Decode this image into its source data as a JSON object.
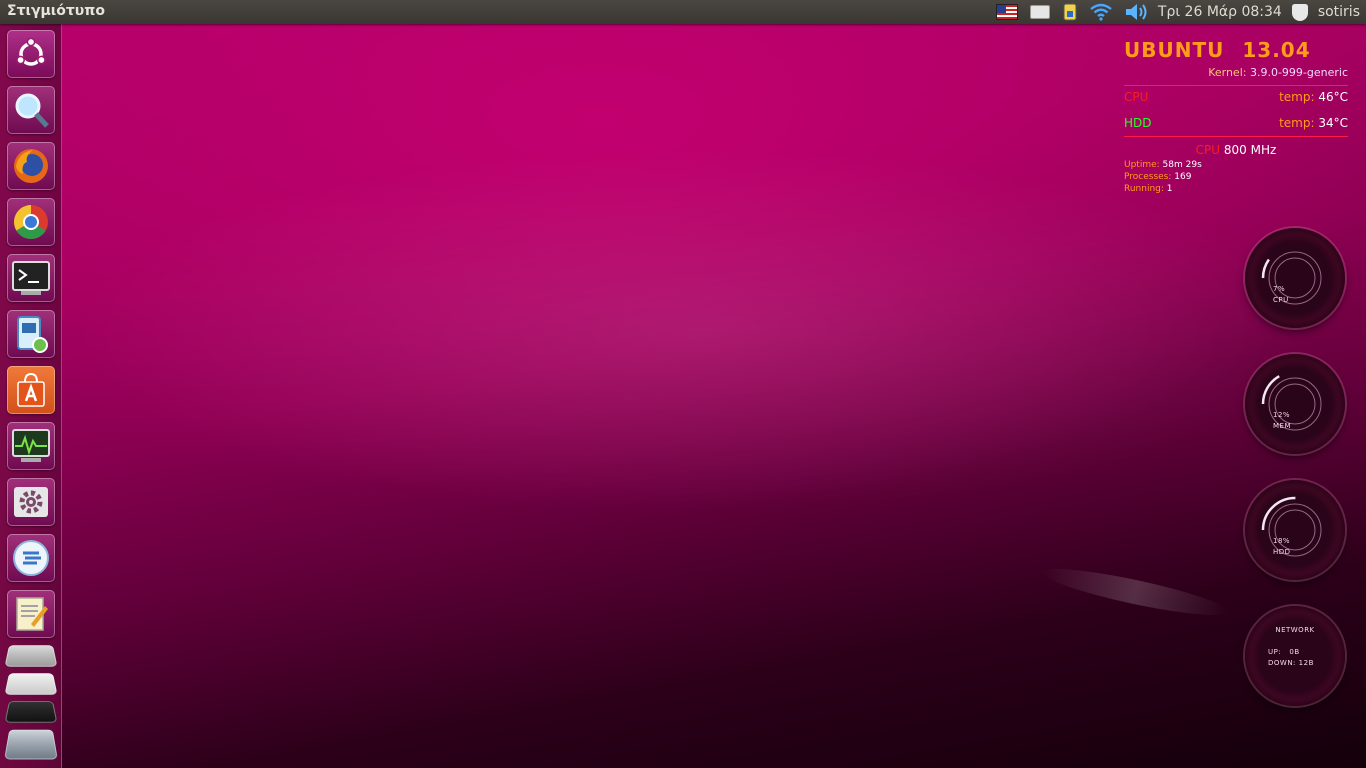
{
  "top_panel": {
    "app_title": "Στιγμιότυπο",
    "clock": "Τρι 26 Μάρ  08:34",
    "user": "sotiris"
  },
  "launcher": {
    "items": [
      {
        "name": "dash-home",
        "icon": "ubuntu-logo-icon"
      },
      {
        "name": "search",
        "icon": "magnifier-icon"
      },
      {
        "name": "firefox",
        "icon": "firefox-icon"
      },
      {
        "name": "chrome",
        "icon": "chrome-icon"
      },
      {
        "name": "terminal",
        "icon": "terminal-icon"
      },
      {
        "name": "screenshot",
        "icon": "screenshot-icon"
      },
      {
        "name": "software-center",
        "icon": "shopping-bag-icon"
      },
      {
        "name": "system-monitor",
        "icon": "monitor-graph-icon"
      },
      {
        "name": "system-settings",
        "icon": "gear-icon"
      },
      {
        "name": "update-manager",
        "icon": "update-icon"
      },
      {
        "name": "text-editor",
        "icon": "notepad-icon"
      }
    ]
  },
  "conky": {
    "os_name": "UBUNTU",
    "os_version": "13.04",
    "kernel_label": "Kernel:",
    "kernel_value": "3.9.0-999-generic",
    "cpu_label": "CPU",
    "cpu_temp_label": "temp:",
    "cpu_temp": "46°C",
    "hdd_label": "HDD",
    "hdd_temp_label": "temp:",
    "hdd_temp": "34°C",
    "freq_label": "CPU",
    "freq_value": "800 MHz",
    "uptime_label": "Uptime:",
    "uptime_value": "58m 29s",
    "processes_label": "Processes:",
    "processes_value": "169",
    "running_label": "Running:",
    "running_value": "1"
  },
  "gauges": {
    "cpu": {
      "value": "7%",
      "label": "CPU",
      "fraction": 0.07
    },
    "mem": {
      "value": "12%",
      "label": "MEM",
      "fraction": 0.12
    },
    "hdd": {
      "value": "18%",
      "label": "HDD",
      "fraction": 0.18
    },
    "network": {
      "title": "NETWORK",
      "up_label": "UP:",
      "up_value": "0B",
      "down_label": "DOWN:",
      "down_value": "12B"
    }
  },
  "colors": {
    "accent_orange": "#ff9c1a",
    "cpu_red": "#ff1d1d",
    "hdd_green": "#29ff29"
  }
}
